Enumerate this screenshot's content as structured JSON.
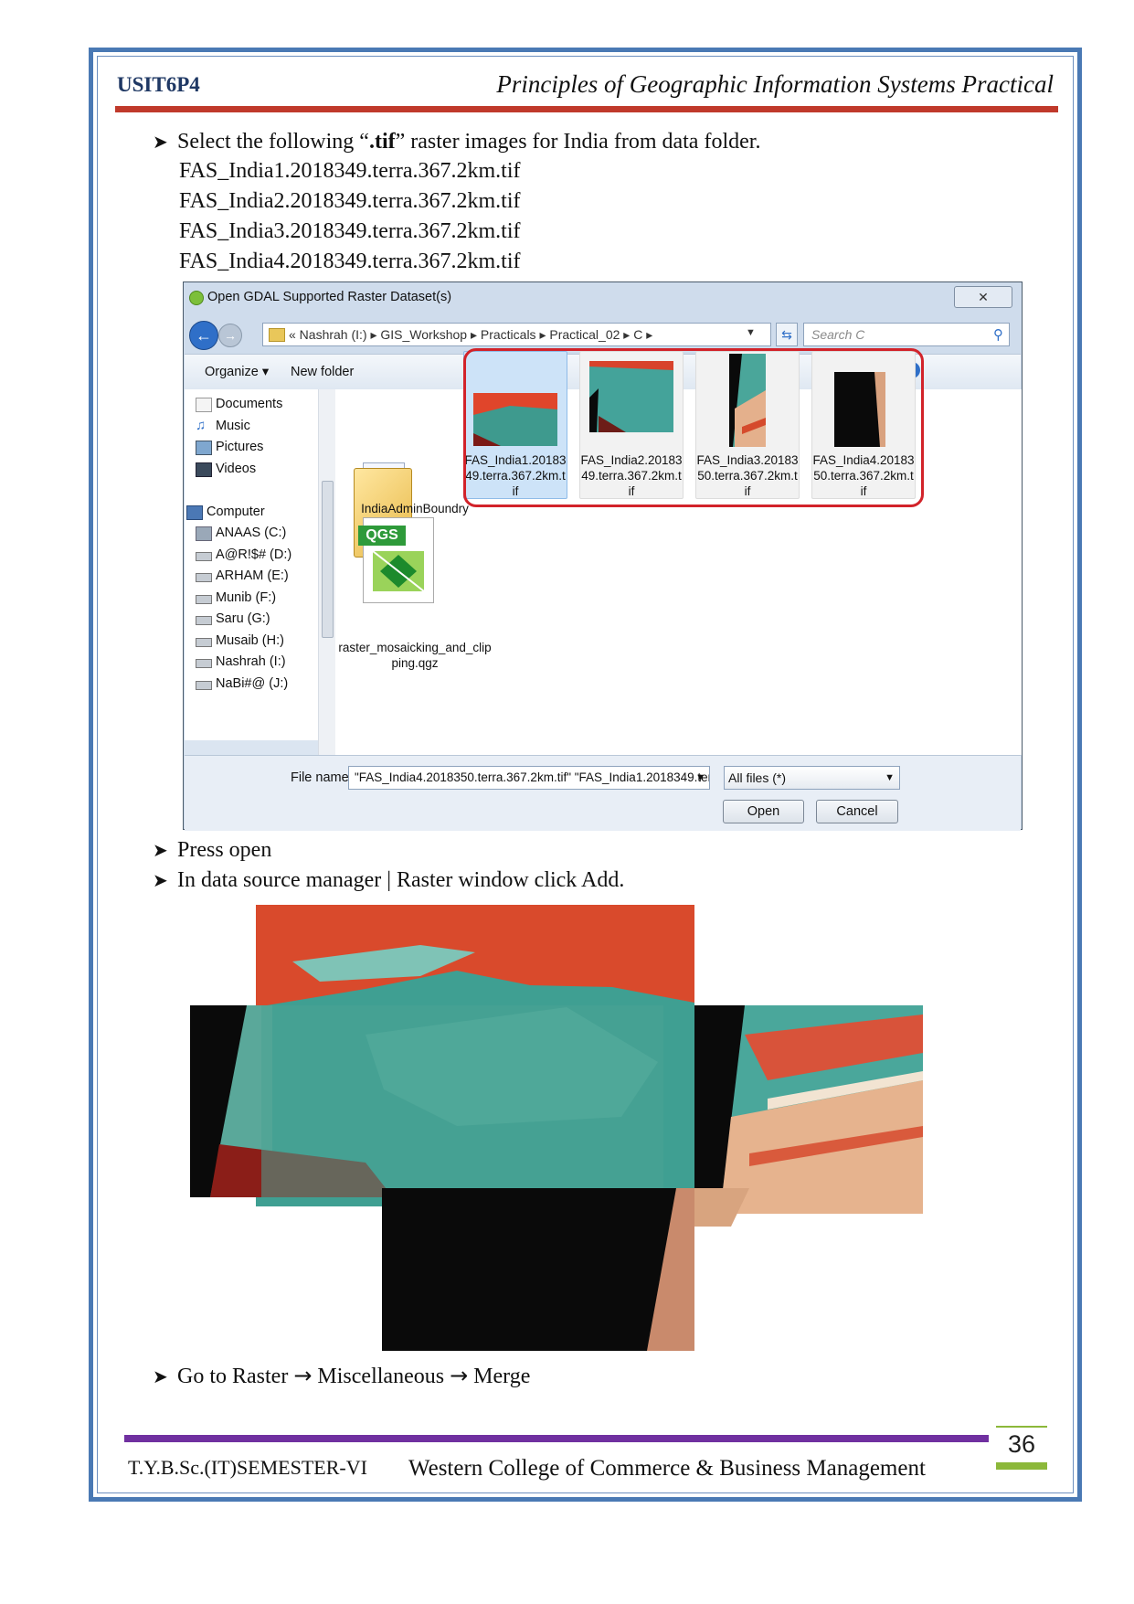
{
  "header": {
    "course_code": "USIT6P4",
    "title": "Principles of Geographic Information Systems Practical"
  },
  "steps": {
    "s1_before": "Select the following “",
    "s1_bold": ".tif",
    "s1_after": "” raster images for India from data folder.",
    "files": [
      "FAS_India1.2018349.terra.367.2km.tif",
      "FAS_India2.2018349.terra.367.2km.tif",
      "FAS_India3.2018349.terra.367.2km.tif",
      "FAS_India4.2018349.terra.367.2km.tif"
    ],
    "s2": "Press open",
    "s3": "In data source manager | Raster window click Add.",
    "s4_a": "Go to Raster ",
    "s4_b": " Miscellaneous ",
    "s4_c": " Merge"
  },
  "dialog": {
    "title": "Open GDAL Supported Raster Dataset(s)",
    "close_label": "✕",
    "address": "« Nashrah (I:) ▸ GIS_Workshop ▸ Practicals ▸ Practical_02 ▸ C ▸",
    "search_placeholder": "Search C",
    "organize_label": "Organize ▾",
    "new_folder_label": "New folder",
    "nav_items": [
      "Documents",
      "Music",
      "Pictures",
      "Videos",
      "Computer",
      "ANAAS (C:)",
      "A@R!$# (D:)",
      "ARHAM (E:)",
      "Munib (F:)",
      "Saru (G:)",
      "Musaib (H:)",
      "Nashrah (I:)",
      "NaBi#@ (J:)"
    ],
    "folder_label": "IndiaAdminBoundry",
    "qgs_tag": "QGS",
    "qgs_label": "raster_mosaicking_and_clipping.qgz",
    "tif_files": [
      "FAS_India1.2018349.terra.367.2km.tif",
      "FAS_India2.2018349.terra.367.2km.tif",
      "FAS_India3.2018350.terra.367.2km.tif",
      "FAS_India4.2018350.terra.367.2km.tif"
    ],
    "file_name_label": "File name:",
    "file_name_value": "\"FAS_India4.2018350.terra.367.2km.tif\" \"FAS_India1.2018349.terra.367.",
    "file_type_value": "All files (*)",
    "open_label": "Open",
    "cancel_label": "Cancel"
  },
  "footer": {
    "left": "T.Y.B.Sc.(IT)SEMESTER-VI",
    "right": "Western College of Commerce & Business Management",
    "page": "36"
  },
  "colors": {
    "border": "#4a79b4",
    "header_rule": "#c0392b",
    "footer_rule": "#7030a0",
    "page_accent": "#8cb83a",
    "selection_box": "#d2232a"
  }
}
